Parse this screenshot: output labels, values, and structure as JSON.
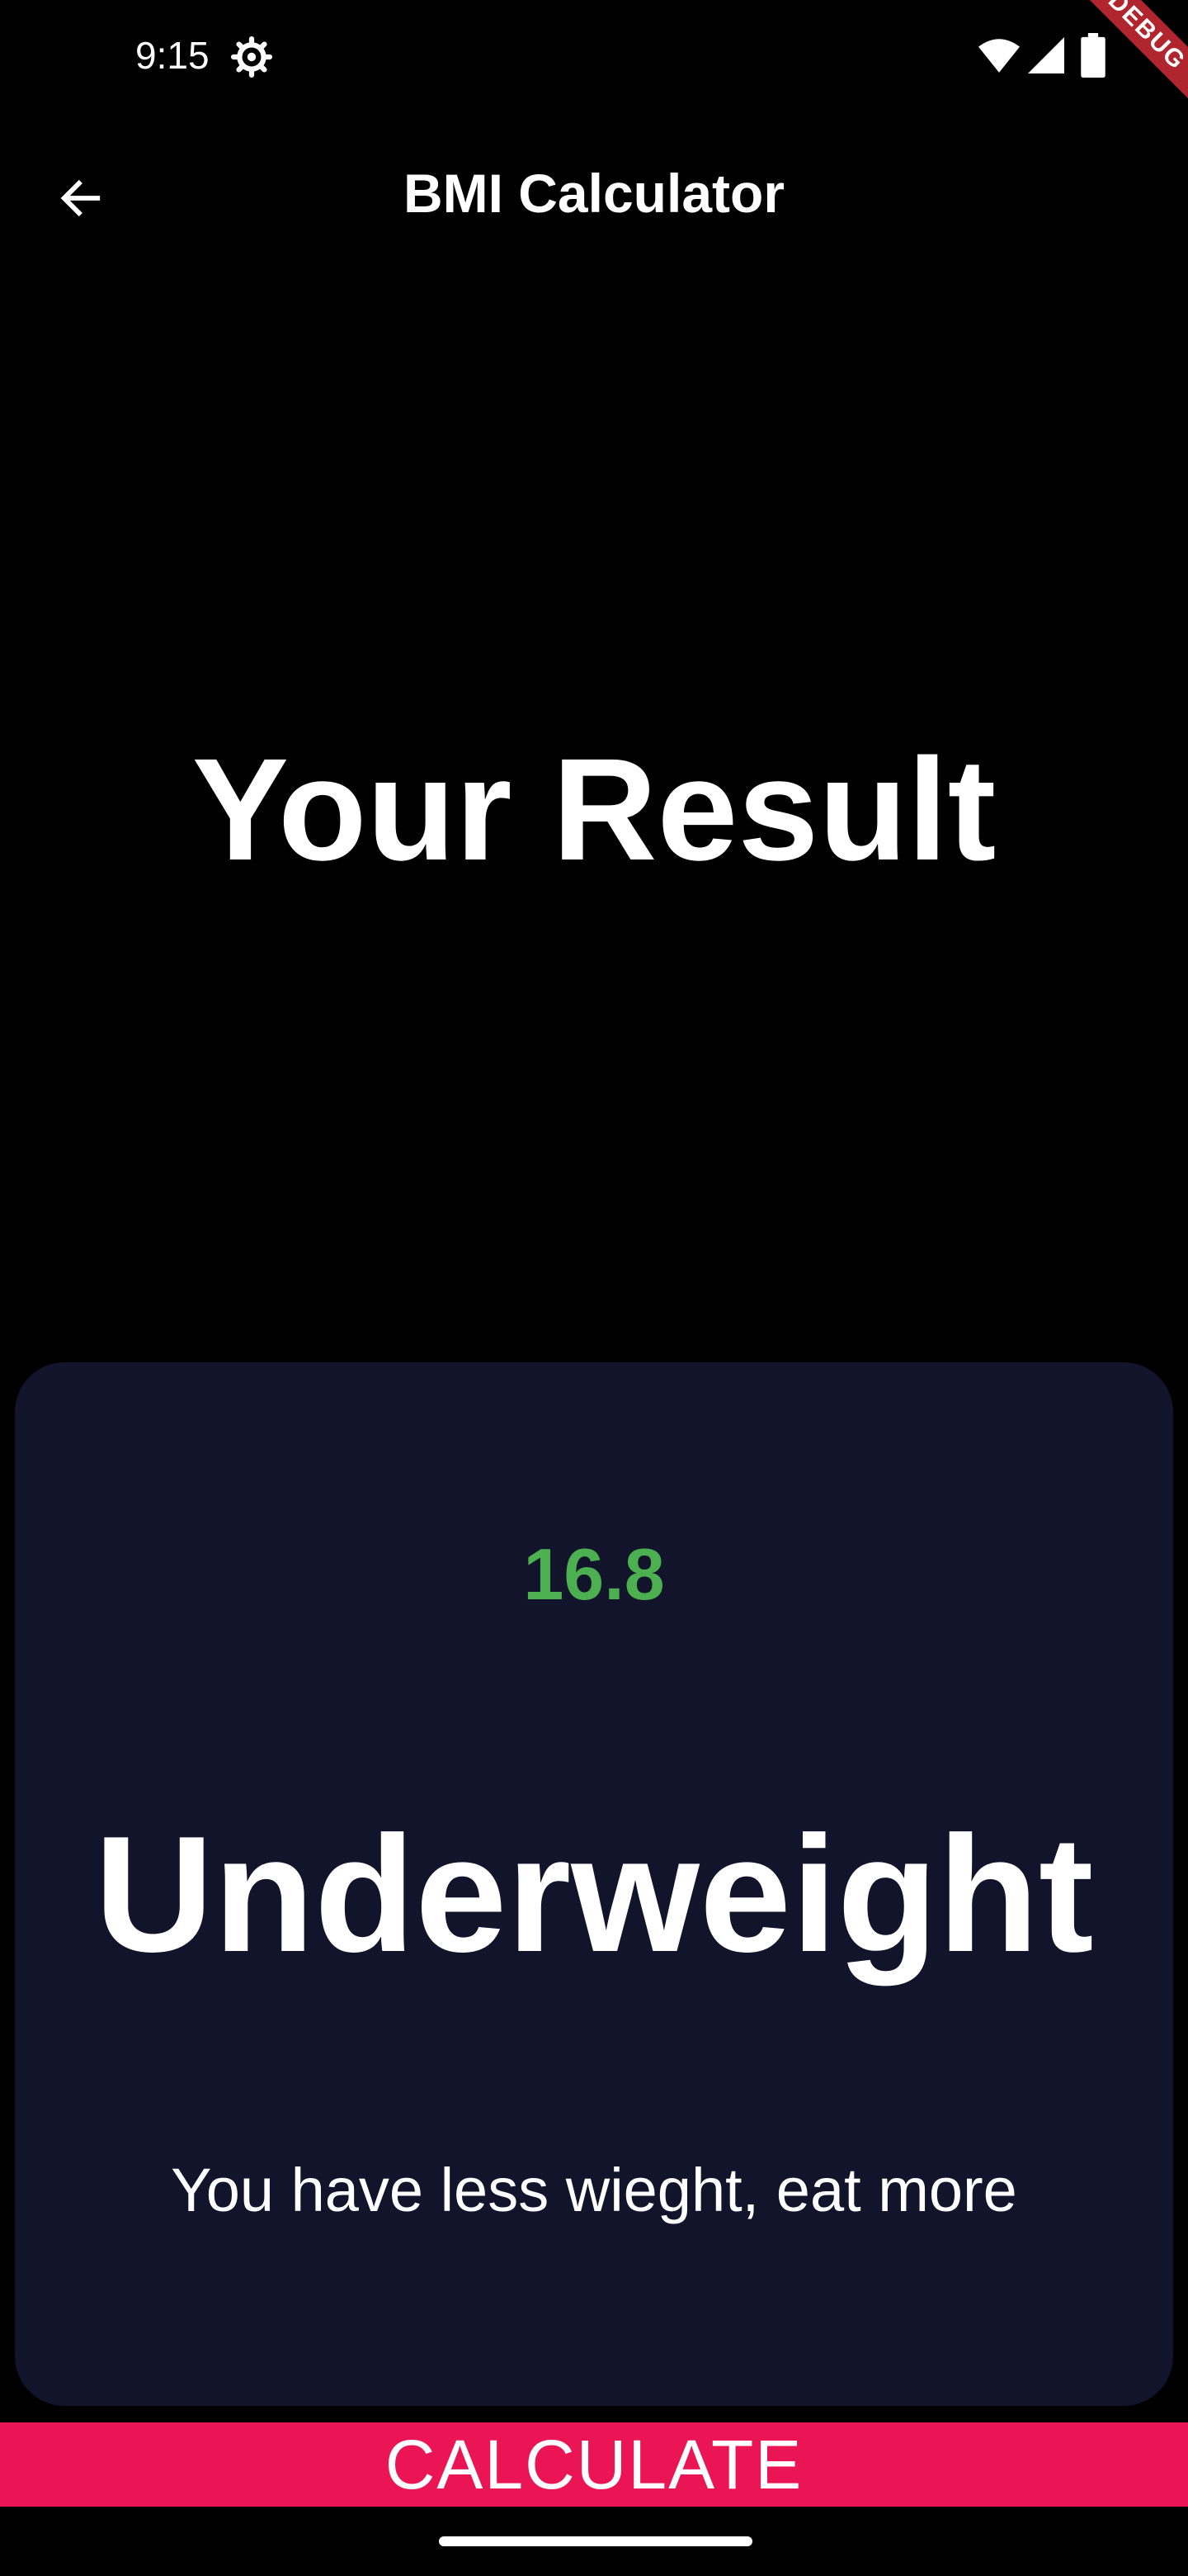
{
  "status_bar": {
    "time": "9:15",
    "icons": [
      "settings-icon",
      "wifi-icon",
      "signal-icon",
      "battery-icon"
    ]
  },
  "debug_banner": {
    "label": "DEBUG"
  },
  "app_bar": {
    "back_icon": "arrow-left-icon",
    "title": "BMI Calculator"
  },
  "main": {
    "heading": "Your Result",
    "card": {
      "bmi_value": "16.8",
      "category": "Underweight",
      "advice": "You have less wieght, eat more"
    }
  },
  "bottom_button": {
    "label": "CALCULATE"
  },
  "colors": {
    "background": "#000000",
    "card": "#11142a",
    "bmi_value": "#4caf50",
    "button": "#eb1555",
    "debug_ribbon": "#b0252e"
  }
}
